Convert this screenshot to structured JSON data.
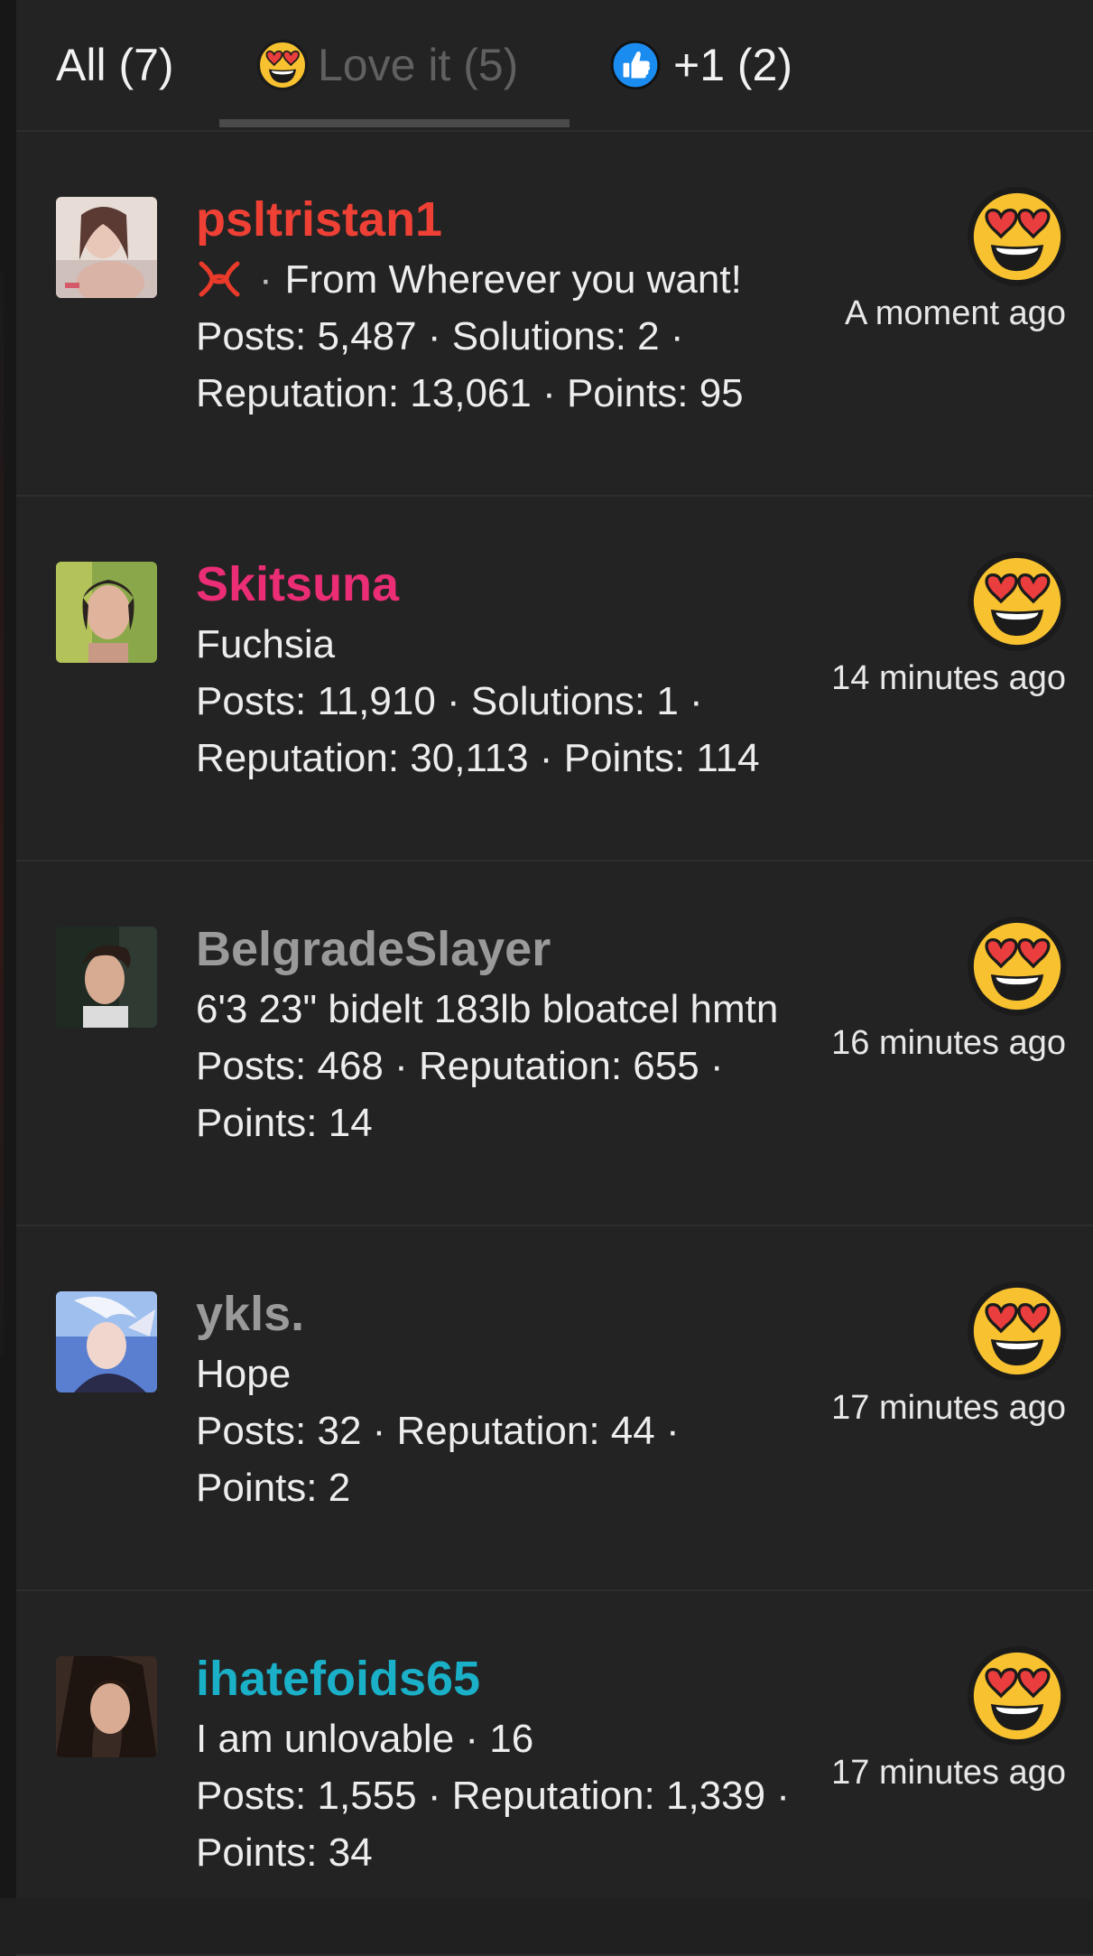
{
  "tabs": [
    {
      "label": "All (7)",
      "icon": "none"
    },
    {
      "label": "Love it (5)",
      "icon": "heart-eyes-emoji-icon"
    },
    {
      "label": "+1 (2)",
      "icon": "thumbs-up-icon"
    }
  ],
  "colors": {
    "red": "#ee4035",
    "pink": "#ea2d74",
    "gray": "#9a9a9a",
    "cyan": "#1ab0c8",
    "background": "#232323"
  },
  "reactions": [
    {
      "username": "psltristan1",
      "username_color": "#ee4035",
      "flair_icon": "anger-symbol-icon",
      "line1": "From Wherever you want!",
      "line2": "Posts: 5,487 · Solutions: 2 ·",
      "line3": "Reputation: 13,061 · Points: 95",
      "time": "A moment ago",
      "reaction_icon": "heart-eyes-emoji-icon"
    },
    {
      "username": "Skitsuna",
      "username_color": "#ea2d74",
      "line1": "Fuchsia",
      "line2": "Posts: 11,910 · Solutions: 1 ·",
      "line3": "Reputation: 30,113 · Points: 114",
      "time": "14 minutes ago",
      "reaction_icon": "heart-eyes-emoji-icon"
    },
    {
      "username": "BelgradeSlayer",
      "username_color": "#9a9a9a",
      "line1": "6'3 23\" bidelt 183lb bloatcel hmtn",
      "line2": "Posts: 468 · Reputation: 655 ·",
      "line3": "Points: 14",
      "time": "16 minutes ago",
      "reaction_icon": "heart-eyes-emoji-icon"
    },
    {
      "username": "ykls.",
      "username_color": "#9a9a9a",
      "line1": "Hope",
      "line2": "Posts: 32 · Reputation: 44 ·",
      "line3": "Points: 2",
      "time": "17 minutes ago",
      "reaction_icon": "heart-eyes-emoji-icon"
    },
    {
      "username": "ihatefoids65",
      "username_color": "#1ab0c8",
      "line1": "I am unlovable · 16",
      "line2": "Posts: 1,555 · Reputation: 1,339 ·",
      "line3": "Points: 34",
      "time": "17 minutes ago",
      "reaction_icon": "heart-eyes-emoji-icon"
    }
  ]
}
